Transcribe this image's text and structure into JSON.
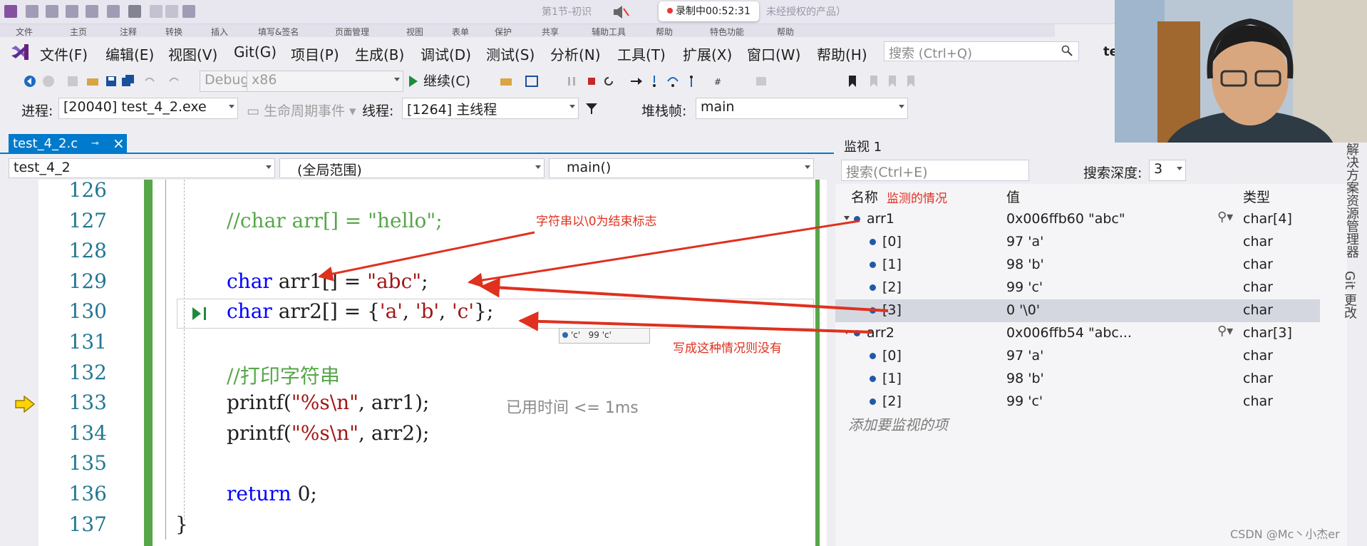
{
  "window": {
    "doc_title": "第1节-初识",
    "doc_title_tail": "未经授权的产品）",
    "record_label": "录制中00:52:31"
  },
  "ribbon_tabs": [
    "文件",
    "主页",
    "注释",
    "转换",
    "插入",
    "填写&签名",
    "页面管理",
    "视图",
    "表单",
    "保护",
    "共享",
    "辅助工具",
    "帮助",
    "特色功能",
    "帮助"
  ],
  "menu": {
    "items": [
      "文件(F)",
      "编辑(E)",
      "视图(V)",
      "Git(G)",
      "项目(P)",
      "生成(B)",
      "调试(D)",
      "测试(S)",
      "分析(N)",
      "工具(T)",
      "扩展(X)",
      "窗口(W)",
      "帮助(H)"
    ],
    "quick_search_placeholder": "搜索 (Ctrl+Q)",
    "title_truncated": "te"
  },
  "toolbar": {
    "config": "Debug",
    "platform": "x86",
    "continue_label": "继续(C)"
  },
  "debug_location": {
    "process_label": "进程:",
    "process_value": "[20040] test_4_2.exe",
    "lifecycle_label": "生命周期事件",
    "thread_label": "线程:",
    "thread_value": "[1264] 主线程",
    "stack_label": "堆栈帧:",
    "stack_value": "main"
  },
  "editor": {
    "tab_label": "test_4_2.c",
    "project_combo": "test_4_2",
    "scope_combo": "(全局范围)",
    "function_combo": "main()",
    "elapsed_label": "已用时间 <= 1ms",
    "datatip": {
      "name": "'c'",
      "value": "99 'c'"
    },
    "lines": [
      {
        "num": "126",
        "segments": []
      },
      {
        "num": "127",
        "segments": [
          {
            "t": "//char arr[] = \"hello\";",
            "c": "cm"
          }
        ]
      },
      {
        "num": "128",
        "segments": []
      },
      {
        "num": "129",
        "segments": [
          {
            "t": "char",
            "c": "kw"
          },
          {
            "t": " arr1[] = ",
            "c": ""
          },
          {
            "t": "\"abc\"",
            "c": "st"
          },
          {
            "t": ";",
            "c": ""
          }
        ]
      },
      {
        "num": "130",
        "segments": [
          {
            "t": "char",
            "c": "kw"
          },
          {
            "t": " arr2[] = {",
            "c": ""
          },
          {
            "t": "'a'",
            "c": "st"
          },
          {
            "t": ", ",
            "c": ""
          },
          {
            "t": "'b'",
            "c": "st"
          },
          {
            "t": ", ",
            "c": ""
          },
          {
            "t": "'c'",
            "c": "st"
          },
          {
            "t": "};",
            "c": ""
          }
        ]
      },
      {
        "num": "131",
        "segments": []
      },
      {
        "num": "132",
        "segments": [
          {
            "t": "//打印字符串",
            "c": "cm"
          }
        ]
      },
      {
        "num": "133",
        "segments": [
          {
            "t": "printf(",
            "c": ""
          },
          {
            "t": "\"%s\\n\"",
            "c": "st"
          },
          {
            "t": ", arr1);",
            "c": ""
          }
        ]
      },
      {
        "num": "134",
        "segments": [
          {
            "t": "printf(",
            "c": ""
          },
          {
            "t": "\"%s\\n\"",
            "c": "st"
          },
          {
            "t": ", arr2);",
            "c": ""
          }
        ]
      },
      {
        "num": "135",
        "segments": []
      },
      {
        "num": "136",
        "segments": [
          {
            "t": "return",
            "c": "kw"
          },
          {
            "t": " 0;",
            "c": ""
          }
        ]
      },
      {
        "num": "137",
        "segments": [
          {
            "t": "}",
            "c": ""
          }
        ]
      }
    ]
  },
  "watch": {
    "title": "监视 1",
    "search_placeholder": "搜索(Ctrl+E)",
    "depth_label": "搜索深度:",
    "depth_value": "3",
    "columns": {
      "name": "名称",
      "value": "值",
      "type": "类型"
    },
    "rows": [
      {
        "name": "arr1",
        "value": "0x006ffb60 \"abc\"",
        "type": "char[4]",
        "level": 0,
        "selected": false
      },
      {
        "name": "[0]",
        "value": "97 'a'",
        "type": "char",
        "level": 1,
        "selected": false
      },
      {
        "name": "[1]",
        "value": "98 'b'",
        "type": "char",
        "level": 1,
        "selected": false
      },
      {
        "name": "[2]",
        "value": "99 'c'",
        "type": "char",
        "level": 1,
        "selected": false
      },
      {
        "name": "[3]",
        "value": "0 '\\0'",
        "type": "char",
        "level": 1,
        "selected": true
      },
      {
        "name": "arr2",
        "value": "0x006ffb54 \"abc...",
        "type": "char[3]",
        "level": 0,
        "selected": false
      },
      {
        "name": "[0]",
        "value": "97 'a'",
        "type": "char",
        "level": 1,
        "selected": false
      },
      {
        "name": "[1]",
        "value": "98 'b'",
        "type": "char",
        "level": 1,
        "selected": false
      },
      {
        "name": "[2]",
        "value": "99 'c'",
        "type": "char",
        "level": 1,
        "selected": false
      }
    ],
    "add_item_placeholder": "添加要监视的项"
  },
  "side_tabs": [
    "解决方案资源管理器",
    "Git 更改"
  ],
  "annotations": {
    "watch_note": "监测的情况",
    "terminator_note": "字符串以\\0为结束标志",
    "no_terminator_note": "写成这种情况则没有"
  },
  "watermark": "CSDN @Mc丶小杰er",
  "colors": {
    "accent": "#007acc",
    "annotation": "#e0301e",
    "change_bar": "#57a64a",
    "keyword": "#0000ff",
    "string": "#a31515",
    "comment": "#57a64a",
    "selected_row": "#d4d7e0"
  }
}
